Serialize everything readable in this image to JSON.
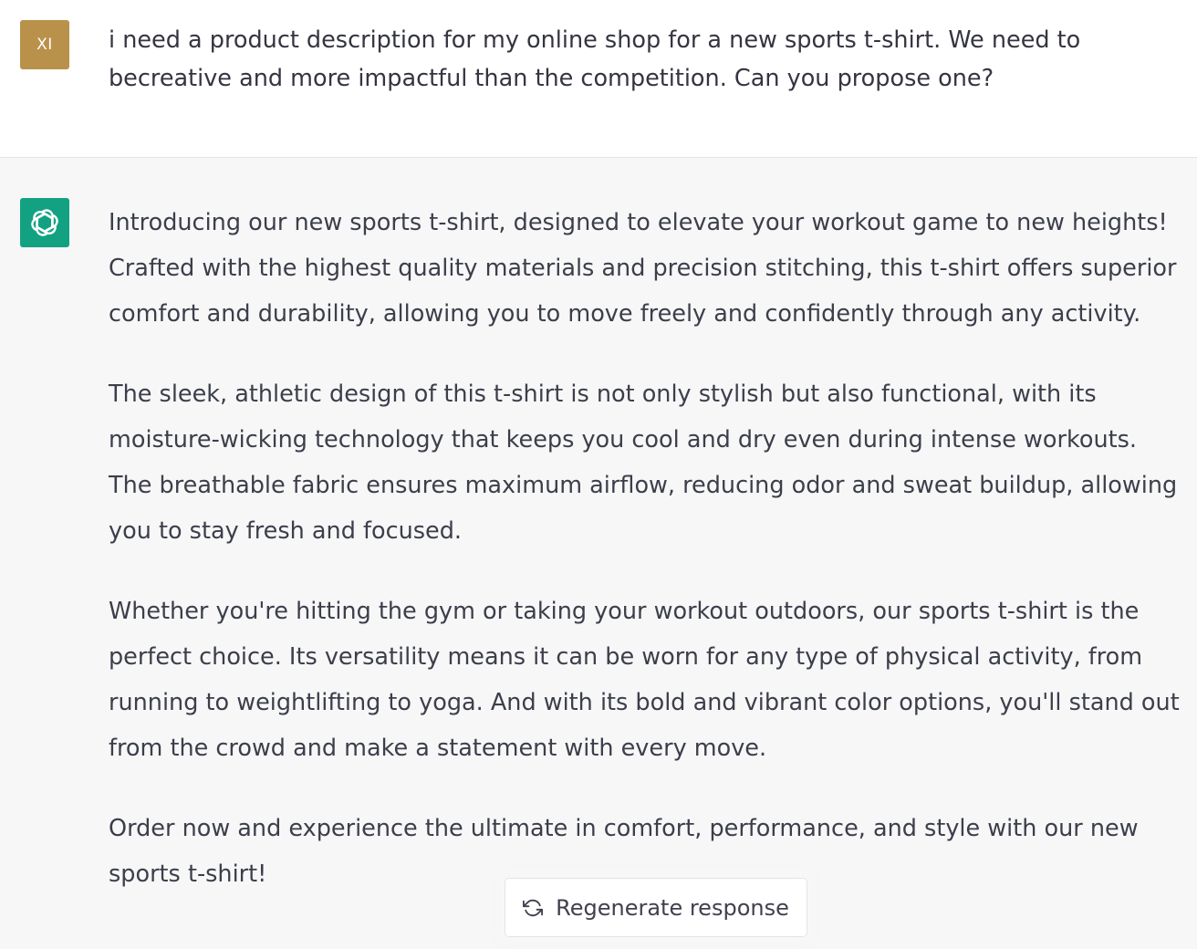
{
  "user": {
    "avatar_initials": "XI",
    "avatar_color": "#b9914a",
    "message": "i need a product description for my online shop for a new sports t-shirt. We need to becreative and more impactful than the competition. Can you propose one?"
  },
  "assistant": {
    "avatar_icon": "openai-logo-icon",
    "avatar_color": "#12a282",
    "paragraphs": [
      "Introducing our new sports t-shirt, designed to elevate your workout game to new heights! Crafted with the highest quality materials and precision stitching, this t-shirt offers superior comfort and durability, allowing you to move freely and confidently through any activity.",
      "The sleek, athletic design of this t-shirt is not only stylish but also functional, with its moisture-wicking technology that keeps you cool and dry even during intense workouts. The breathable fabric ensures maximum airflow, reducing odor and sweat buildup, allowing you to stay fresh and focused.",
      "Whether you're hitting the gym or taking your workout outdoors, our sports t-shirt is the perfect choice. Its versatility means it can be worn for any type of physical activity, from running to weightlifting to yoga. And with its bold and vibrant color options, you'll stand out from the crowd and make a statement with every move.",
      "Order now and experience the ultimate in comfort, performance, and style with our new sports t-shirt!"
    ]
  },
  "regenerate": {
    "label": "Regenerate response",
    "icon": "refresh-icon"
  }
}
